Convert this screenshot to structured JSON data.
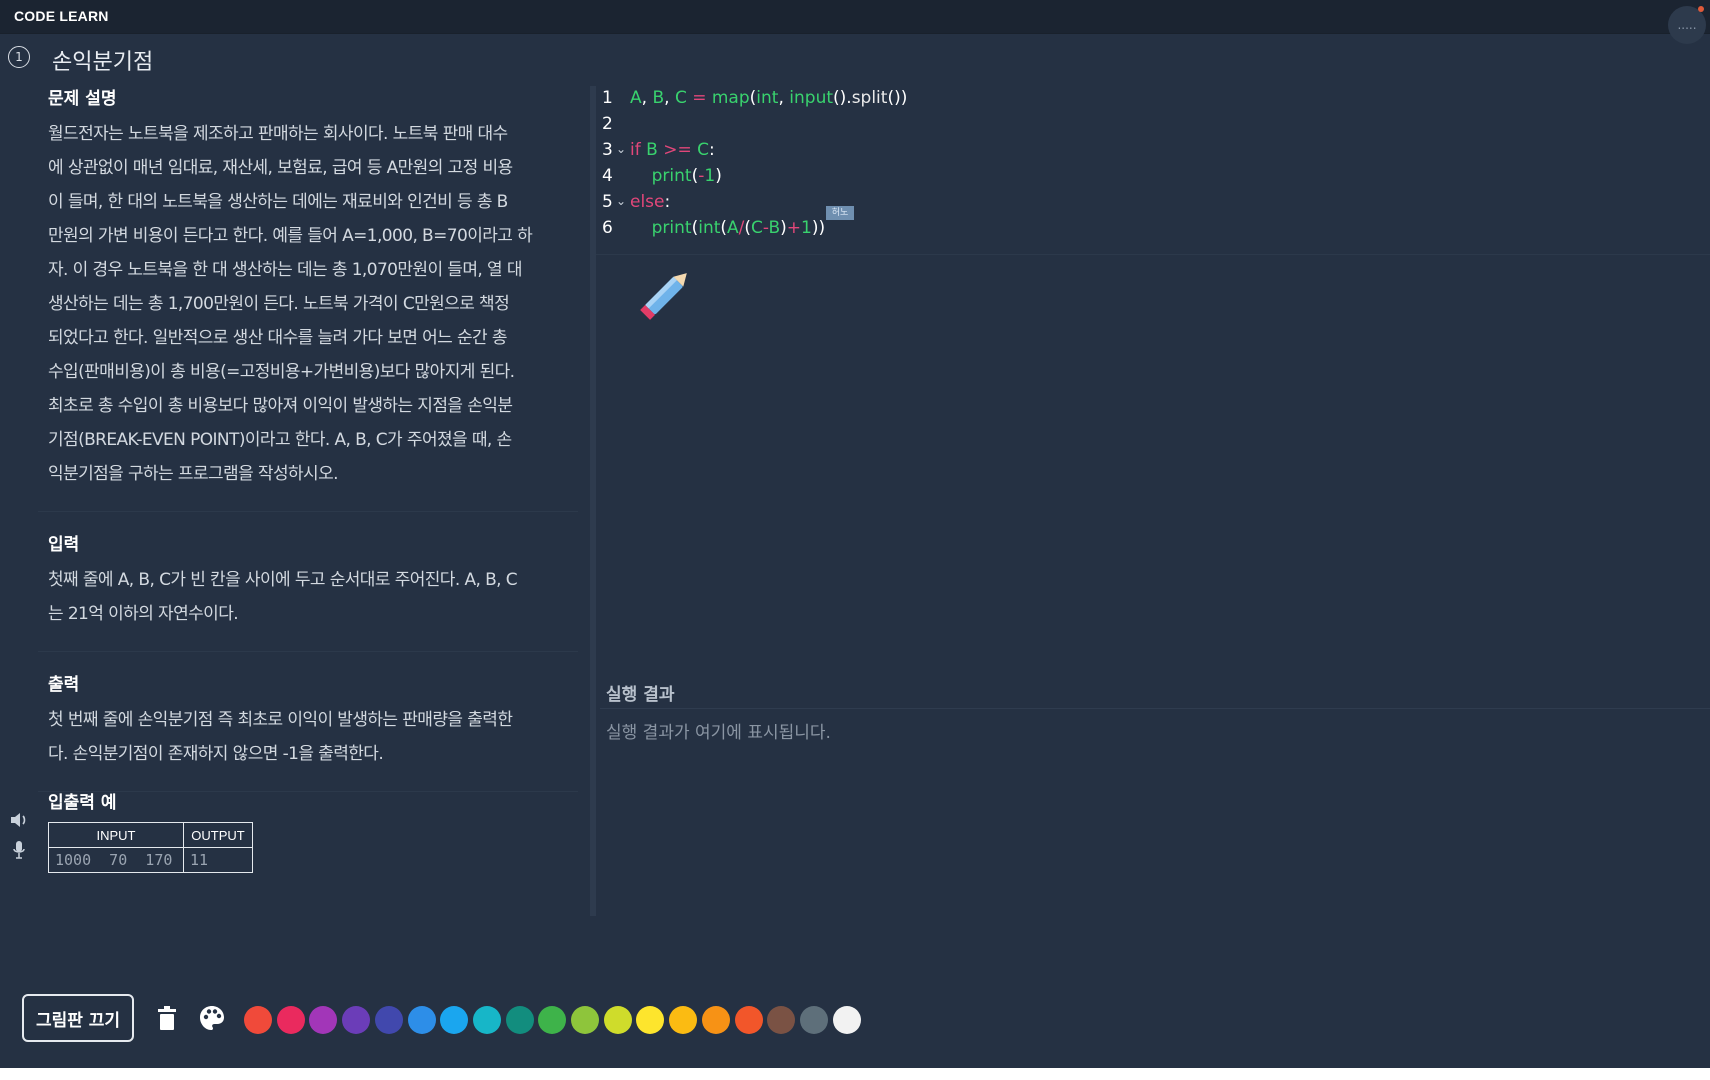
{
  "app": {
    "name": "CODE LEARN",
    "menu_dots": "....."
  },
  "problem": {
    "number": "1",
    "title": "손익분기점"
  },
  "description": {
    "title": "문제 설명",
    "lines": [
      "월드전자는 노트북을 제조하고 판매하는 회사이다. 노트북 판매 대수",
      "에 상관없이 매년 임대료, 재산세, 보험료, 급여 등 A만원의 고정 비용",
      "이 들며, 한 대의 노트북을 생산하는 데에는 재료비와 인건비 등 총 B",
      "만원의 가변 비용이 든다고 한다. 예를 들어 A=1,000, B=70이라고 하",
      "자. 이 경우 노트북을 한 대 생산하는 데는 총 1,070만원이 들며, 열 대",
      "생산하는 데는 총 1,700만원이 든다. 노트북 가격이 C만원으로 책정",
      "되었다고 한다. 일반적으로 생산 대수를 늘려 가다 보면 어느 순간 총",
      "수입(판매비용)이 총 비용(=고정비용+가변비용)보다 많아지게 된다.",
      "최초로 총 수입이 총 비용보다 많아져 이익이 발생하는 지점을 손익분",
      "기점(BREAK-EVEN POINT)이라고 한다. A, B, C가 주어졌을 때, 손",
      "익분기점을 구하는 프로그램을 작성하시오."
    ]
  },
  "input_section": {
    "title": "입력",
    "lines": [
      "첫째 줄에 A, B, C가 빈 칸을 사이에 두고 순서대로 주어진다. A, B, C",
      "는 21억 이하의 자연수이다."
    ]
  },
  "output_section": {
    "title": "출력",
    "lines": [
      "첫 번째 줄에 손익분기점 즉 최초로 이익이 발생하는 판매량을 출력한",
      "다. 손익분기점이 존재하지 않으면 -1을 출력한다."
    ]
  },
  "examples": {
    "title": "입출력 예",
    "headers": [
      "INPUT",
      "OUTPUT"
    ],
    "rows": [
      {
        "input": "1000  70  170",
        "output": "11"
      }
    ]
  },
  "editor": {
    "lines": [
      {
        "num": "1",
        "text": "A, B, C = map(int, input().split())"
      },
      {
        "num": "2",
        "text": ""
      },
      {
        "num": "3",
        "text": "if B >= C:"
      },
      {
        "num": "4",
        "text": "    print(-1)"
      },
      {
        "num": "5",
        "text": "else:"
      },
      {
        "num": "6",
        "text": "    print(int(A/(C-B)+1))"
      }
    ],
    "cursor_tag": "허노"
  },
  "result": {
    "title": "실행 결과",
    "placeholder": "실행 결과가 여기에 표시됩니다."
  },
  "toolbar": {
    "draw_toggle_label": "그림판 끄기",
    "swatches": [
      "#f04a3a",
      "#ea2a5e",
      "#a236b8",
      "#6b3db8",
      "#4148ad",
      "#2d8ee8",
      "#1aa6ef",
      "#17b6c8",
      "#128d7e",
      "#3eb34a",
      "#8ec53b",
      "#cfdc2b",
      "#fde52d",
      "#fbbb12",
      "#f79215",
      "#f2562a",
      "#7a5244",
      "#5e6f7a",
      "#f2f2f2"
    ]
  }
}
